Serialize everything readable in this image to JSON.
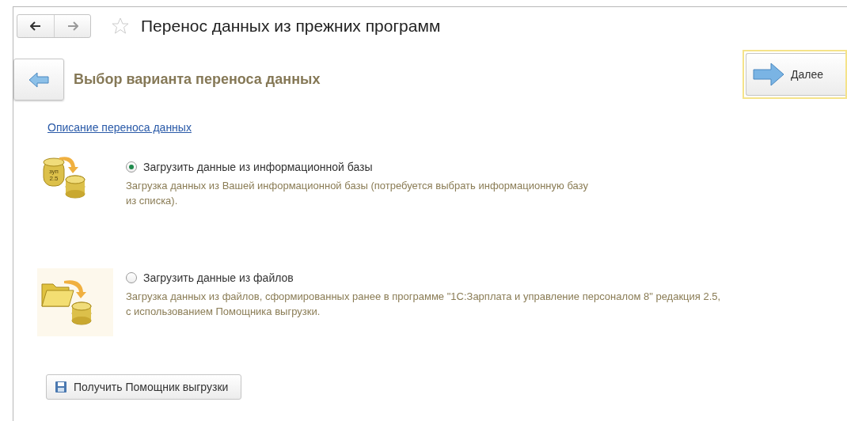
{
  "window": {
    "title": "Перенос данных из прежних программ"
  },
  "header": {
    "title": "Выбор варианта переноса данных",
    "next_button": "Далее"
  },
  "link": "Описание переноса данных",
  "options": [
    {
      "kind": "database",
      "label": "Загрузить данные из информационной базы",
      "description": "Загрузка данных из Вашей информационной базы (потребуется выбрать информационную базу из списка).",
      "icon_text": [
        "зуп",
        "2.5"
      ],
      "selected": true
    },
    {
      "kind": "files",
      "label": "Загрузить данные из файлов",
      "description": "Загрузка данных из файлов, сформированных ранее в программе \"1С:Зарплата и управление персоналом 8\" редакция 2.5, с использованием Помощника выгрузки.",
      "selected": false
    }
  ],
  "bottom_button": "Получить Помощник выгрузки"
}
